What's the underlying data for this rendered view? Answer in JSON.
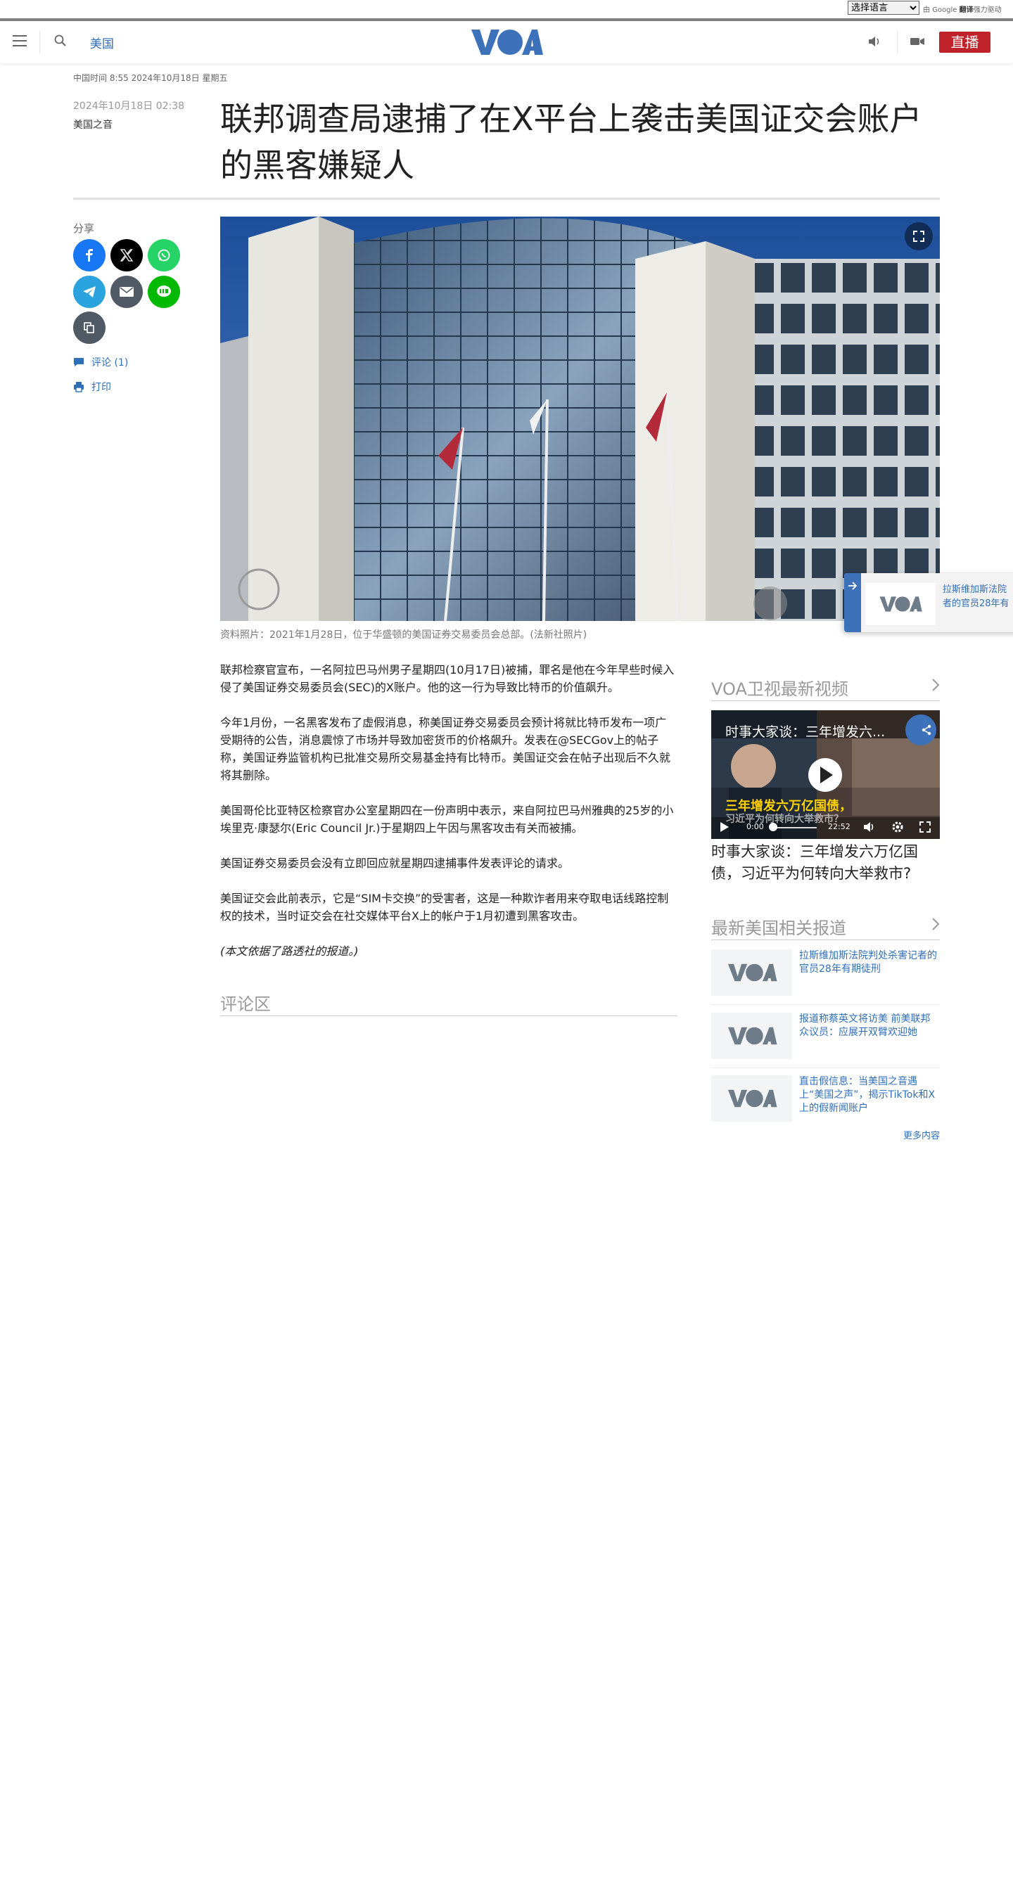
{
  "translate_bar": {
    "select_value": "选择语言",
    "powered_prefix": "由",
    "google": "Google",
    "translate": "翻译",
    "powered_suffix": "强力驱动"
  },
  "header": {
    "section": "美国",
    "live": "直播",
    "logo_text": "VOA"
  },
  "article": {
    "dateline": "中国时间 8:55 2024年10月18日 星期五",
    "pubdate": "2024年10月18日 02:38",
    "author": "美国之音",
    "title": "联邦调查局逮捕了在X平台上袭击美国证交会账户的黑客嫌疑人",
    "share_label": "分享",
    "comments": "评论 (1)",
    "print": "打印",
    "caption": "资料照片：2021年1月28日，位于华盛顿的美国证券交易委员会总部。(法新社照片)",
    "paragraphs": [
      "联邦检察官宣布，一名阿拉巴马州男子星期四(10月17日)被捕，罪名是他在今年早些时候入侵了美国证券交易委员会(SEC)的X账户。他的这一行为导致比特币的价值飙升。",
      "今年1月份，一名黑客发布了虚假消息，称美国证券交易委员会预计将就比特币发布一项广受期待的公告，消息震惊了市场并导致加密货币的价格飙升。发表在@SECGov上的帖子称，美国证券监管机构已批准交易所交易基金持有比特币。美国证交会在帖子出现后不久就将其删除。",
      "美国哥伦比亚特区检察官办公室星期四在一份声明中表示，来自阿拉巴马州雅典的25岁的小埃里克·康瑟尔(Eric Council Jr.)于星期四上午因与黑客攻击有关而被捕。",
      "美国证券交易委员会没有立即回应就星期四逮捕事件发表评论的请求。",
      "美国证交会此前表示，它是“SIM卡交换”的受害者，这是一种欺诈者用来夺取电话线路控制权的技术，当时证交会在社交媒体平台X上的帐户于1月初遭到黑客攻击。",
      "(本文依据了路透社的报道。)"
    ],
    "comment_section": "评论区"
  },
  "float_card": {
    "text_line1": "拉斯维加斯法院",
    "text_line2": "者的官员28年有"
  },
  "sidebar": {
    "video_heading": "VOA卫视最新视频",
    "video_overlay_title": "时事大家谈：三年增发六...",
    "video_banner_line1": "三年增发六万亿国债，",
    "video_banner_line2": "习近平为何转向大举救市？",
    "video_time_current": "0:00",
    "video_time_total": "22:52",
    "video_title": "时事大家谈：三年增发六万亿国债，习近平为何转向大举救市?",
    "related_heading": "最新美国相关报道",
    "related": [
      "拉斯维加斯法院判处杀害记者的官员28年有期徒刑",
      "报道称蔡英文将访美 前美联邦众议员：应展开双臂欢迎她",
      "直击假信息：当美国之音遇上“美国之声”，揭示TikTok和X上的假新闻账户"
    ],
    "more": "更多内容"
  },
  "colors": {
    "accent_blue": "#2f6fb8",
    "live_red": "#c0222a",
    "facebook": "#1877f2",
    "x": "#000000",
    "whatsapp": "#25d366",
    "telegram": "#2aa3df",
    "email": "#505a64",
    "line": "#00b900",
    "copy": "#505a64"
  }
}
